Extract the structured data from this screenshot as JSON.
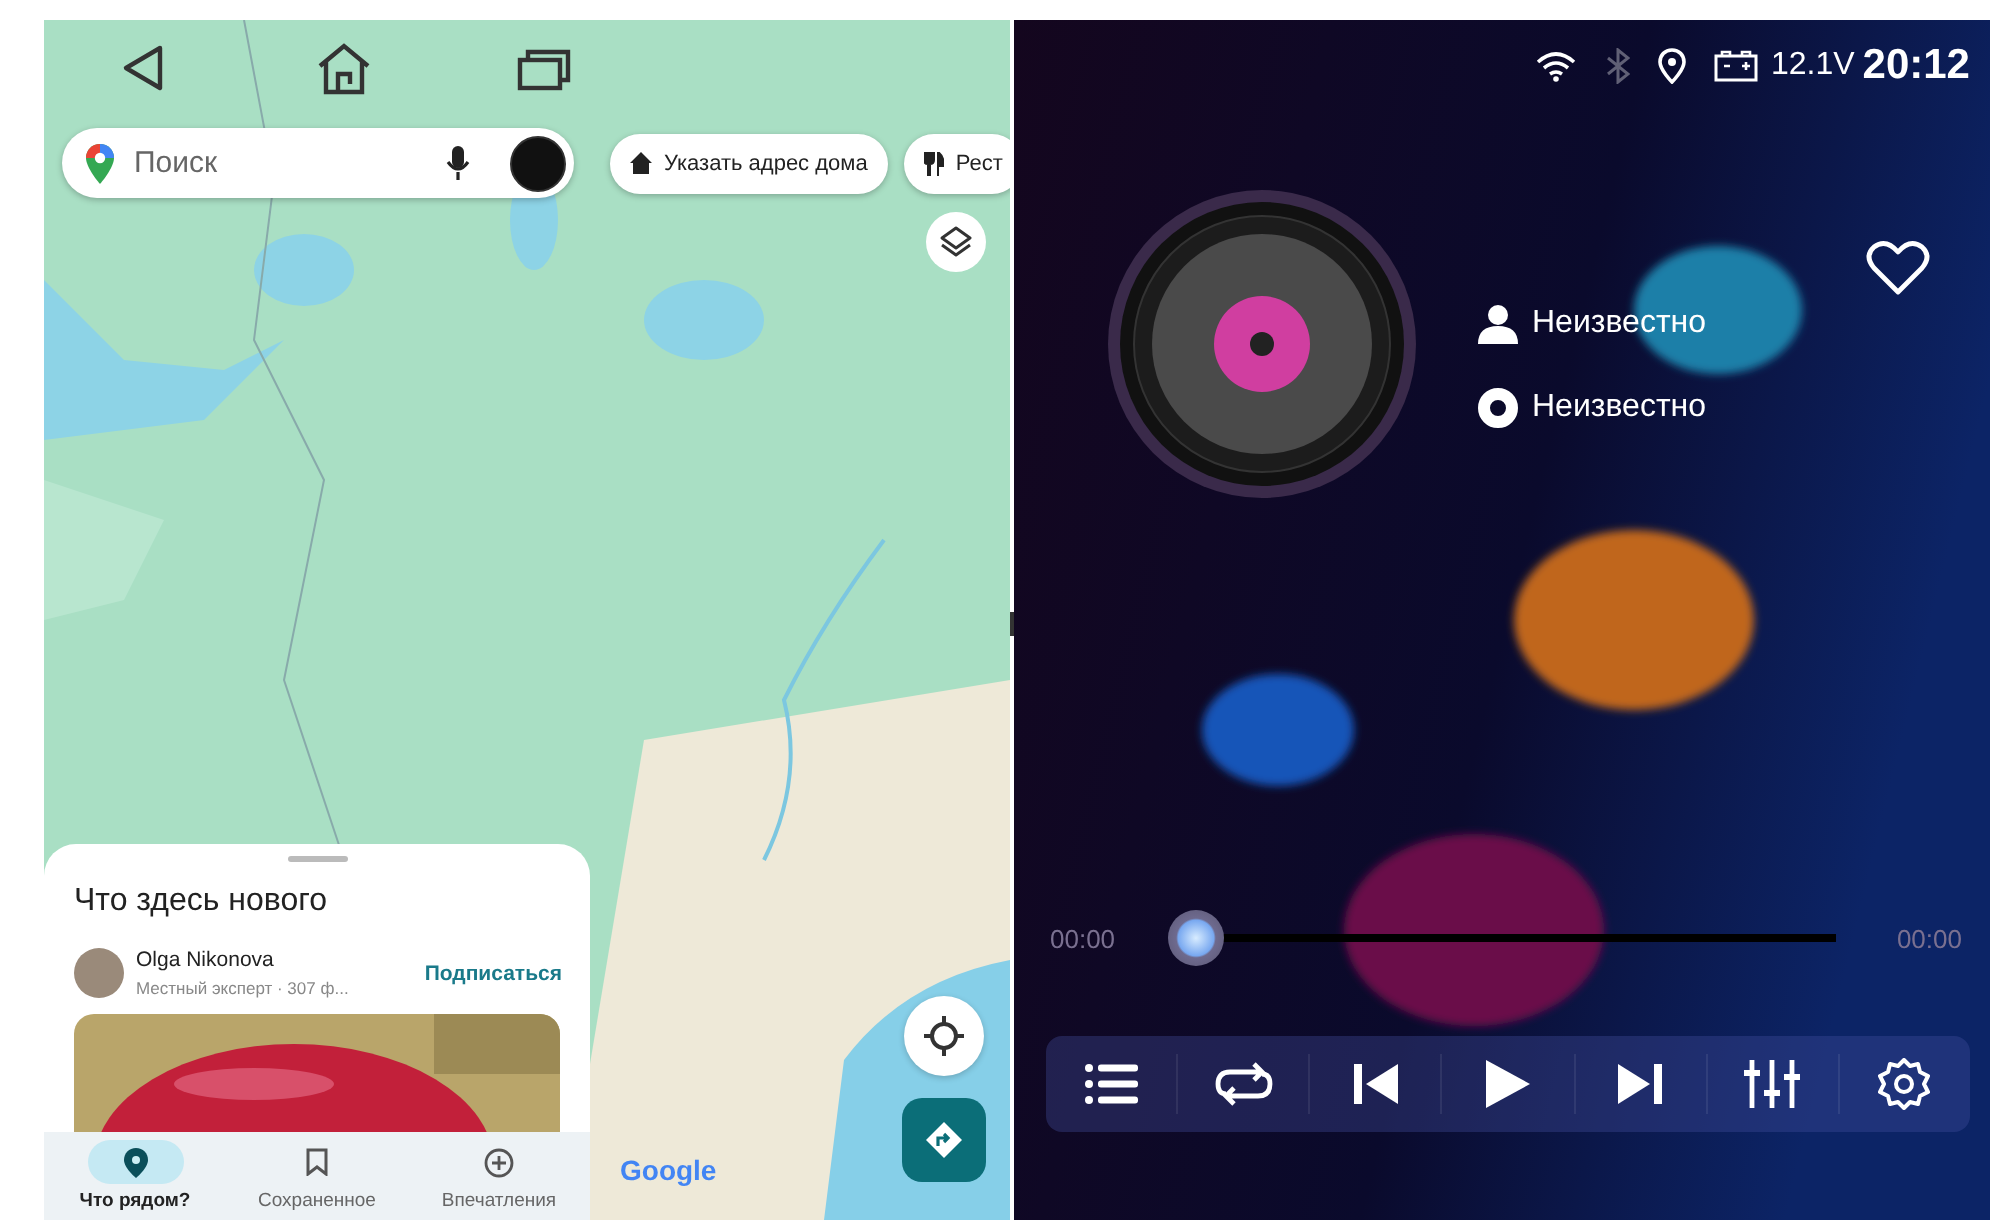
{
  "system_nav": [
    {
      "kind": "back"
    },
    {
      "kind": "home"
    },
    {
      "kind": "recents"
    }
  ],
  "maps": {
    "search": {
      "placeholder": "Поиск"
    },
    "chips": [
      {
        "kind": "home",
        "label": "Указать адрес дома"
      },
      {
        "kind": "restaurant",
        "label": "Рест"
      }
    ],
    "attribution": "Google",
    "sheet": {
      "title": "Что здесь нового",
      "post": {
        "author": "Olga Nikonova",
        "subtitle": "Местный эксперт · 307 ф...",
        "action": "Подписаться"
      },
      "tabs": [
        {
          "kind": "nearby",
          "label": "Что рядом?",
          "selected": true
        },
        {
          "kind": "saved",
          "label": "Сохраненное",
          "selected": false
        },
        {
          "kind": "contribute",
          "label": "Впечатления",
          "selected": false
        }
      ]
    }
  },
  "status_bar": {
    "icons": [
      {
        "kind": "wifi",
        "on": true
      },
      {
        "kind": "bluetooth",
        "on": false
      },
      {
        "kind": "location",
        "on": true
      },
      {
        "kind": "battery",
        "on": true
      }
    ],
    "voltage": "12.1V",
    "time": "20:12"
  },
  "player": {
    "favorite": false,
    "info": [
      {
        "kind": "artist",
        "text": "Неизвестно"
      },
      {
        "kind": "album",
        "text": "Неизвестно"
      }
    ],
    "progress": {
      "level": 0,
      "elapsed": "00:00",
      "total": "00:00"
    },
    "controls": [
      {
        "kind": "playlist"
      },
      {
        "kind": "repeat"
      },
      {
        "kind": "previous"
      },
      {
        "kind": "play"
      },
      {
        "kind": "next"
      },
      {
        "kind": "equalizer"
      },
      {
        "kind": "settings"
      }
    ]
  }
}
